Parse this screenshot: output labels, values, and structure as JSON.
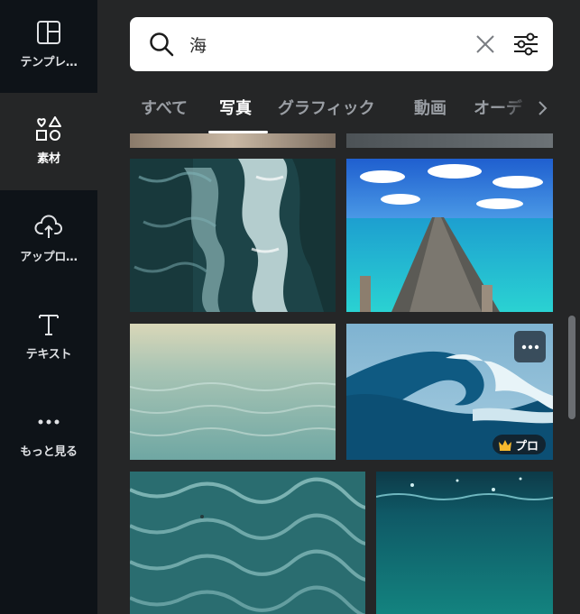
{
  "sidebar": {
    "items": [
      {
        "label": "テンプレ…",
        "icon": "template-layout-icon"
      },
      {
        "label": "素材",
        "icon": "elements-shapes-icon"
      },
      {
        "label": "アップロ…",
        "icon": "cloud-upload-icon"
      },
      {
        "label": "テキスト",
        "icon": "text-T-icon"
      },
      {
        "label": "もっと見る",
        "icon": "more-dots-icon"
      }
    ],
    "active_index": 1
  },
  "search": {
    "value": "海",
    "icon": "search-icon",
    "clear_icon": "close-icon",
    "filter_icon": "sliders-filter-icon"
  },
  "tabs": [
    {
      "label": "すべて"
    },
    {
      "label": "写真"
    },
    {
      "label": "グラフィック"
    },
    {
      "label": "動画"
    },
    {
      "label": "オーデ"
    }
  ],
  "active_tab_index": 1,
  "photos": {
    "badge_label": "プロ",
    "badge_icon": "crown-icon",
    "more_icon": "more-horizontal-icon"
  },
  "colors": {
    "sidebar_bg": "#0e1318",
    "panel_bg": "#252627",
    "pro_crown": "#f5b92e"
  }
}
